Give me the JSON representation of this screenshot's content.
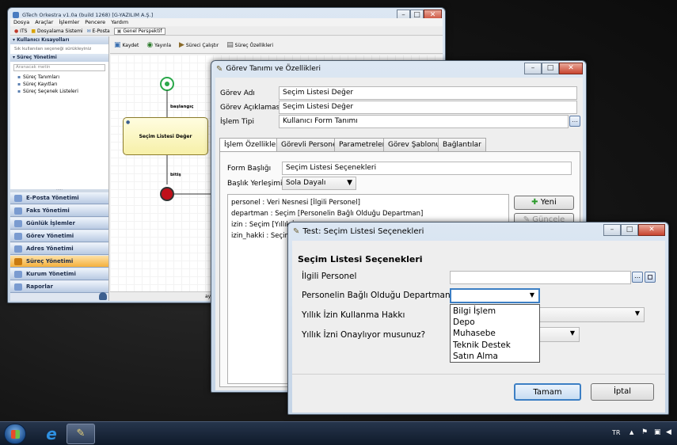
{
  "main_window": {
    "title": "GTech Orkestra v1.0a (build 1268) [G-YAZILIM A.Ş.]",
    "menu": [
      "Dosya",
      "Araçlar",
      "İşlemler",
      "Pencere",
      "Yardım"
    ],
    "toolbar": [
      "ITS",
      "Dosyalama Sistemi",
      "E-Posta",
      "Genel Perspektif"
    ],
    "left": {
      "kullanici_header": "Kullanıcı Kısayolları",
      "kullanici_hint": "Sık kullanılan seçeneği sürükleyiniz",
      "surec_header": "Süreç Yönetimi",
      "search_placeholder": "Aranacak metin",
      "tree": [
        "Süreç Tanımları",
        "Süreç Kayıtları",
        "Süreç Seçenek Listeleri"
      ]
    },
    "nav": [
      "E-Posta Yönetimi",
      "Faks Yönetimi",
      "Günlük İşlemler",
      "Görev Yönetimi",
      "Adres Yönetimi",
      "Süreç Yönetimi",
      "Kurum Yönetimi",
      "Raporlar"
    ],
    "nav_active": "Süreç Yönetimi",
    "editor_toolbar": [
      "Kaydet",
      "Yayınla",
      "Süreci Çalıştır",
      "Süreç Özellikleri"
    ],
    "diagram": {
      "start_label": "başlangıç",
      "task_label": "Seçim Listesi Değer",
      "end_label": "bitiş"
    },
    "statusbar_text": "ay"
  },
  "gorev_window": {
    "title": "Görev Tanımı ve Özellikleri",
    "fields": [
      {
        "label": "Görev Adı",
        "value": "Seçim Listesi Değer"
      },
      {
        "label": "Görev Açıklaması",
        "value": "Seçim Listesi Değer"
      },
      {
        "label": "İşlem Tipi",
        "value": "Kullanıcı Form Tanımı"
      }
    ],
    "tabs": [
      "İşlem Özellikleri",
      "Görevli Personel",
      "Parametreler",
      "Görev Şablonu",
      "Bağlantılar"
    ],
    "form_baslik_label": "Form Başlığı",
    "form_baslik_value": "Seçim Listesi Seçenekleri",
    "baslik_yerlesimi_label": "Başlık Yerleşimi",
    "baslik_yerlesimi_value": "Sola Dayalı",
    "list": [
      "personel : Veri Nesnesi [İlgili Personel]",
      "departman : Seçim [Personelin Bağlı Olduğu Departman]",
      "izin : Seçim [Yıllık İ",
      "izin_hakki : Seçim ["
    ],
    "yeni": "Yeni",
    "guncelle": "Güncele"
  },
  "test_window": {
    "title": "Test: Seçim Listesi Seçenekleri",
    "header": "Seçim Listesi Seçenekleri",
    "labels": [
      "İlgili Personel",
      "Personelin Bağlı Olduğu Departman",
      "Yıllık İzin Kullanma Hakkı",
      "Yıllık İzni Onaylıyor musunuz?"
    ],
    "dropdown_options": [
      "Bilgi İşlem",
      "Depo",
      "Muhasebe",
      "Teknik Destek",
      "Satın Alma"
    ],
    "tamam": "Tamam",
    "iptal": "İptal"
  },
  "taskbar": {
    "lang": "TR"
  },
  "colors": {
    "nav_active": "#f5b03c",
    "taskbar": "#0f1a2a",
    "end_event": "#c0101a",
    "start_event": "#2aa84a"
  }
}
